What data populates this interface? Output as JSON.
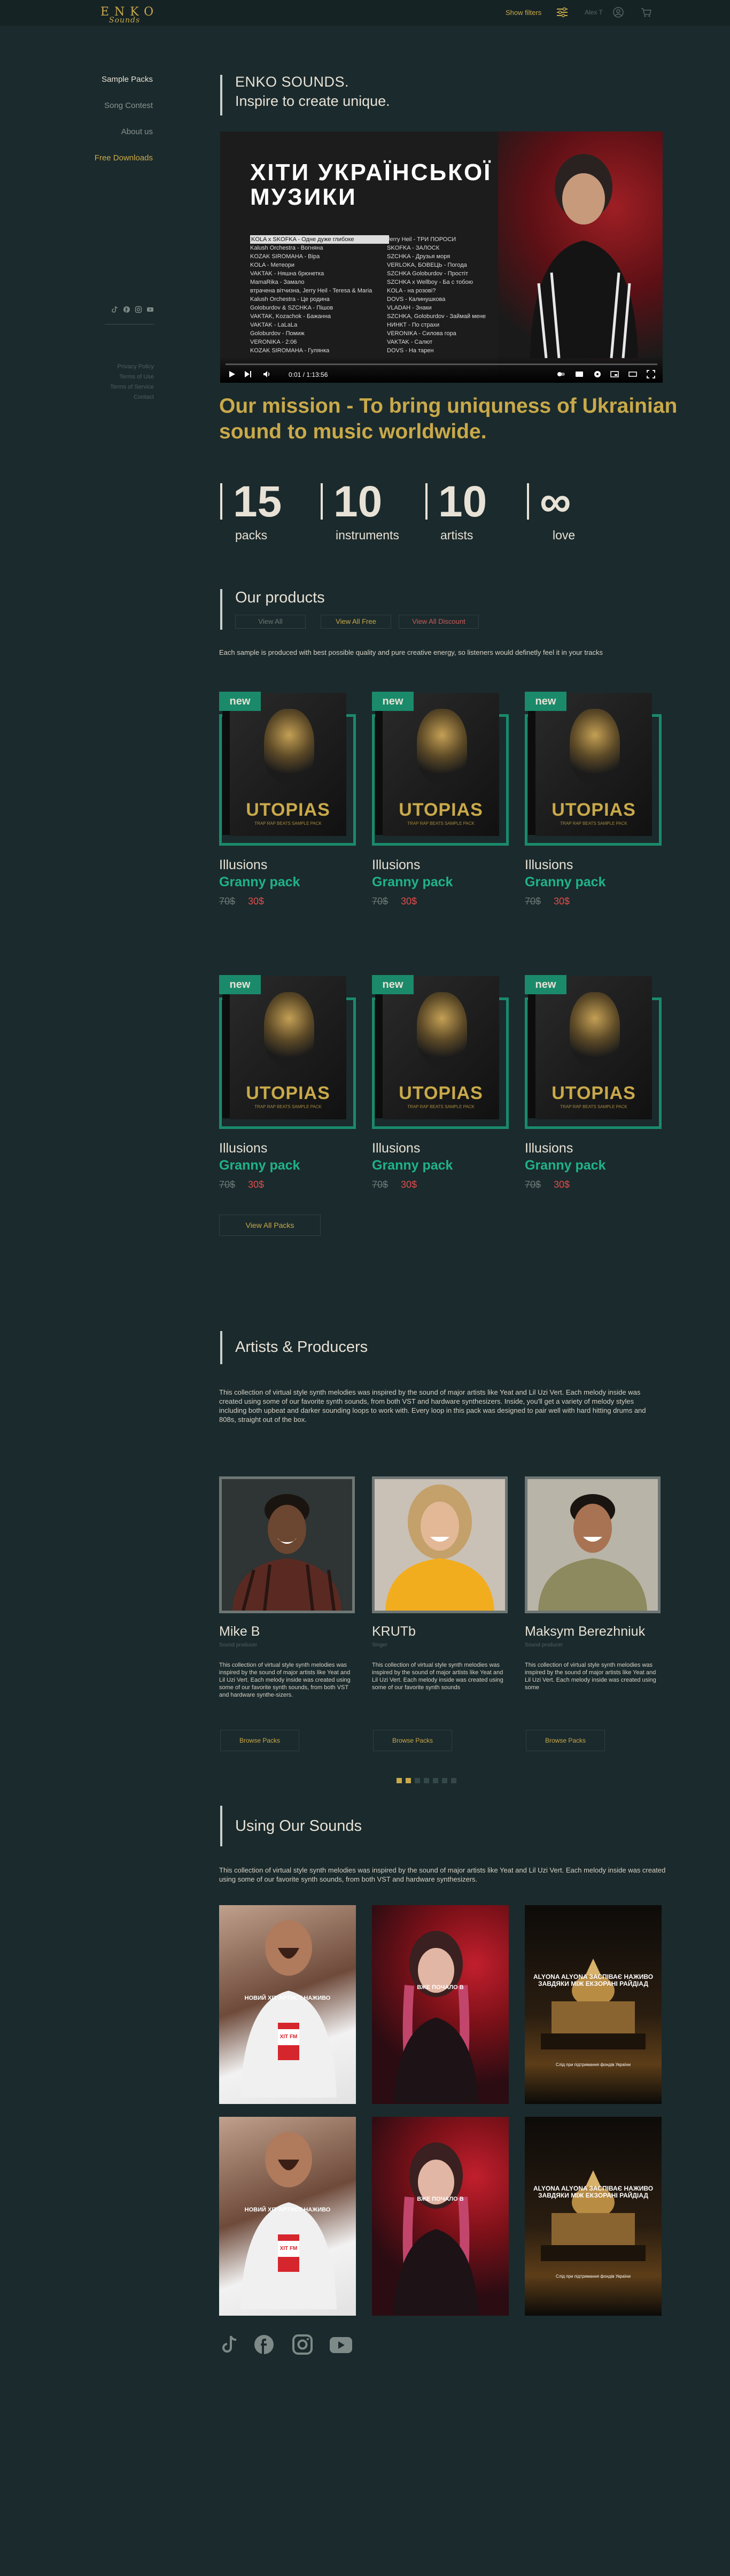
{
  "header": {
    "logo_top": "ENKO",
    "logo_bottom": "Sounds",
    "show_filters": "Show filters",
    "user_name": "Alex T"
  },
  "sidebar": {
    "items": [
      {
        "label": "Sample Packs"
      },
      {
        "label": "Song Contest"
      },
      {
        "label": "About us"
      },
      {
        "label": "Free Downloads"
      }
    ],
    "links": [
      {
        "label": "Privacy Policy"
      },
      {
        "label": "Terms of Use"
      },
      {
        "label": "Terms of Service"
      },
      {
        "label": "Contact"
      }
    ]
  },
  "hero": {
    "title1": "ENKO SOUNDS.",
    "title2": "Inspire to create unique."
  },
  "video": {
    "title": "ХІТИ УКРАЇНСЬКОЇ МУЗИКИ",
    "time": "0:01 / 1:13:56",
    "col1": [
      "KOLA x SKOFKA - Одне дуже глибоке",
      "Kalush Orchestra - Вогняна",
      "KOZAK SIROMAHA - Віра",
      "KOLA - Метеори",
      "VAKTAK - Няшна брюнетка",
      "MamaRika - Замало",
      "втрачена вітчизна, Jerry Heil - Teresa & Maria",
      "Kalush Orchestra - Це родина",
      "Goloburdov & SZCHKA - Пiшов",
      "VAKTAK, Kozachok - Бажанна",
      "VAKTAK - LaLaLa",
      "Goloburdov - Помиж",
      "VERONIKA - 2:06",
      "KOZAK SIROMAHA - Гулянка"
    ],
    "col2": [
      "Jerry Heil - ТРИ ПОРОСИ",
      "SKOFKA - ЗАЛОСК",
      "SZCHKA - Друзья моря",
      "VERLOKA, БОВЕЦЬ - Погода",
      "SZCHKA Goloburdov - Простіт",
      "SZCHKA x Wellboy - Ба с тобою",
      "KOLA - на розові?",
      "DOVS - Калинушкова",
      "VLADAH - Знаки",
      "SZCHKA, Goloburdov - Займай мене",
      "НИНКТ - По страхи",
      "VERONIKA - Силова гора",
      "VAKTAK - Салют",
      "DOVS - На тарен"
    ]
  },
  "mission": "Our mission - To bring uniquness of Ukrainian sound to music worldwide.",
  "stats": [
    {
      "num": "15",
      "label": "packs"
    },
    {
      "num": "10",
      "label": "instruments"
    },
    {
      "num": "10",
      "label": "artists"
    },
    {
      "num": "∞",
      "label": "love"
    }
  ],
  "products": {
    "title": "Our products",
    "tabs": [
      "View All",
      "View All Free",
      "View All Discount"
    ],
    "desc": "Each sample is produced with best possible quality and pure creative energy, so listeners would definetly feel it in your tracks",
    "new_label": "new",
    "box_title": "UTOPIAS",
    "box_sub": "TRAP RAP BEATS SAMPLE PACK",
    "items": [
      {
        "name": "Illusions",
        "pack": "Granny pack",
        "old": "70$",
        "new": "30$"
      },
      {
        "name": "Illusions",
        "pack": "Granny pack",
        "old": "70$",
        "new": "30$"
      },
      {
        "name": "Illusions",
        "pack": "Granny pack",
        "old": "70$",
        "new": "30$"
      },
      {
        "name": "Illusions",
        "pack": "Granny pack",
        "old": "70$",
        "new": "30$"
      },
      {
        "name": "Illusions",
        "pack": "Granny pack",
        "old": "70$",
        "new": "30$"
      },
      {
        "name": "Illusions",
        "pack": "Granny pack",
        "old": "70$",
        "new": "30$"
      }
    ],
    "view_all": "View All Packs"
  },
  "artists": {
    "title": "Artists & Producers",
    "desc": "This collection of virtual style synth melodies was inspired by the sound of major artists like Yeat and Lil Uzi Vert. Each melody inside was created using some of our favorite synth sounds, from both VST and hardware synthesizers. Inside, you'll get a variety of melody styles including both upbeat and darker sounding loops to work with. Every loop in this pack was designed to pair well with hard hitting drums and 808s, straight out of the box.",
    "items": [
      {
        "name": "Mike B",
        "role": "Sound producer",
        "bio": "This collection of virtual style synth melodies was inspired by the sound of major artists like Yeat and Lil Uzi Vert. Each melody inside was created using some of our favorite synth sounds, from both VST and hardware synthe-sizers.",
        "btn": "Browse Packs"
      },
      {
        "name": "KRUTb",
        "role": "Singer",
        "bio": "This collection of virtual style synth melodies was inspired by the sound of major artists like Yeat and Lil Uzi Vert. Each melody inside was created using some of our favorite synth sounds",
        "btn": "Browse Packs"
      },
      {
        "name": "Maksym Berezhniuk",
        "role": "Sound producer",
        "bio": "This collection of virtual style synth melodies was inspired by the sound of major artists like Yeat and Lil Uzi Vert. Each melody inside was created using some",
        "btn": "Browse Packs"
      }
    ]
  },
  "usage": {
    "title": "Using Our Sounds",
    "desc": "This collection of virtual style synth melodies was inspired by the sound of major artists like Yeat and Lil Uzi Vert. Each melody inside was created using some of our favorite synth sounds, from both VST and hardware synthesizers.",
    "videos": [
      {
        "cap": "НОВИЙ ХІТ АРТИСТ НАЖИВО"
      },
      {
        "cap": "ВЖЕ ПОЧАЛО В"
      },
      {
        "cap": "ALYONA ALYONA ЗАСПІВАЄ НАЖИВО ЗАВДЯКИ МІЖ ЕКЗОРАНІ РАЙДІАД",
        "sub": "Слід при підтримання фондів України"
      },
      {
        "cap": "НОВИЙ ХІТ АРТИСТ НАЖИВО"
      },
      {
        "cap": "ВЖЕ ПОЧАЛО В"
      },
      {
        "cap": "ALYONA ALYONA ЗАСПІВАЄ НАЖИВО ЗАВДЯКИ МІЖ ЕКЗОРАНІ РАЙДІАД",
        "sub": "Слід при підтримання фондів України"
      }
    ],
    "badge": "ХІТ FM"
  },
  "colors": {
    "bg": "#1b2a2c",
    "gold": "#c9a94a",
    "green": "#1a8a6b",
    "sale": "#e24c4c"
  }
}
